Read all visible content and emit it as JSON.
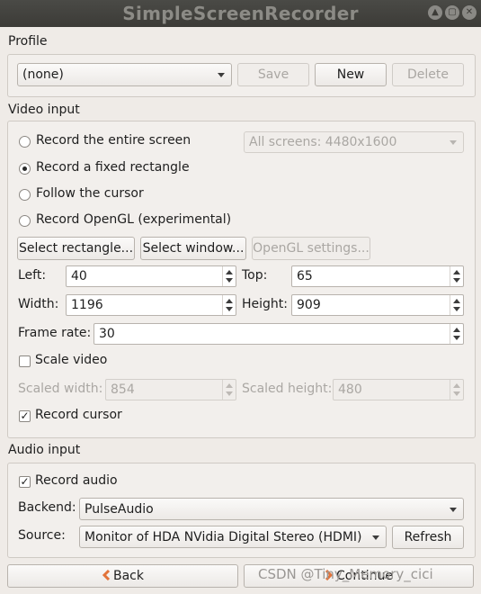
{
  "window": {
    "title": "SimpleScreenRecorder",
    "controls": [
      "▲",
      "▢",
      "✕"
    ]
  },
  "profile": {
    "section": "Profile",
    "selected": "(none)",
    "save": "Save",
    "new": "New",
    "delete": "Delete"
  },
  "video": {
    "section": "Video input",
    "radios": [
      "Record the entire screen",
      "Record a fixed rectangle",
      "Follow the cursor",
      "Record OpenGL (experimental)"
    ],
    "selected_radio": "Record a fixed rectangle",
    "screens": "All screens: 4480x1600",
    "select_rectangle": "Select rectangle...",
    "select_window": "Select window...",
    "opengl_settings": "OpenGL settings...",
    "left_label": "Left:",
    "left": "40",
    "top_label": "Top:",
    "top": "65",
    "width_label": "Width:",
    "width": "1196",
    "height_label": "Height:",
    "height": "909",
    "frame_rate_label": "Frame rate:",
    "frame_rate": "30",
    "scale_video": "Scale video",
    "scale_video_checked": false,
    "scaled_width_label": "Scaled width:",
    "scaled_width": "854",
    "scaled_height_label": "Scaled height:",
    "scaled_height": "480",
    "record_cursor": "Record cursor",
    "record_cursor_checked": true
  },
  "audio": {
    "section": "Audio input",
    "record_audio": "Record audio",
    "record_audio_checked": true,
    "backend_label": "Backend:",
    "backend": "PulseAudio",
    "source_label": "Source:",
    "source": "Monitor of HDA NVidia Digital Stereo (HDMI)",
    "refresh": "Refresh"
  },
  "footer": {
    "back": "Back",
    "continue": "Continue",
    "back_icon": "chevron-left-icon",
    "continue_icon": "chevron-right-icon"
  },
  "watermark": "CSDN @Tiny_Memory_cici",
  "colors": {
    "titlebar": "#3c3b37",
    "window_bg": "#efebe7",
    "arrow_accent": "#e2733a"
  }
}
